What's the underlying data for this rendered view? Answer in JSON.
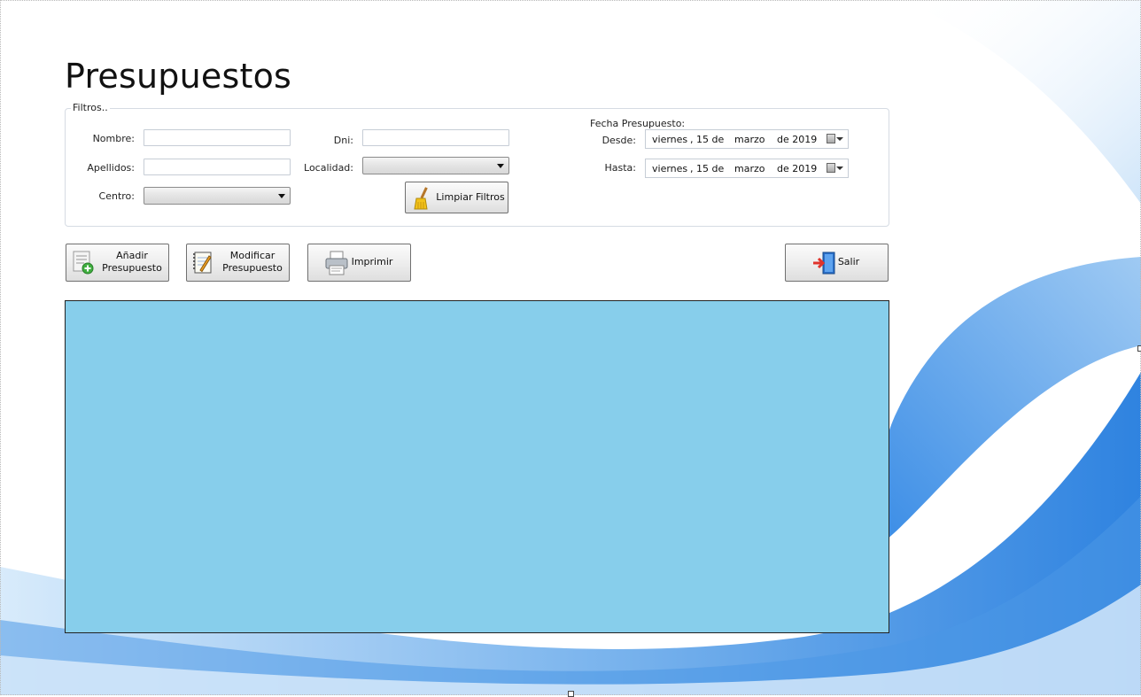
{
  "page": {
    "title": "Presupuestos"
  },
  "filters": {
    "legend": "Filtros..",
    "nombre_label": "Nombre:",
    "nombre_value": "",
    "apellidos_label": "Apellidos:",
    "apellidos_value": "",
    "centro_label": "Centro:",
    "centro_value": "",
    "dni_label": "Dni:",
    "dni_value": "",
    "localidad_label": "Localidad:",
    "localidad_value": "",
    "clear_button": "Limpiar Filtros",
    "fecha_heading": "Fecha Presupuesto:",
    "desde_label": "Desde:",
    "hasta_label": "Hasta:",
    "desde": {
      "weekday": "viernes",
      "day": ", 15 de",
      "month": "marzo",
      "year": "de 2019"
    },
    "hasta": {
      "weekday": "viernes",
      "day": ", 15 de",
      "month": "marzo",
      "year": "de 2019"
    }
  },
  "toolbar": {
    "add": {
      "line1": "Añadir",
      "line2": "Presupuesto"
    },
    "edit": {
      "line1": "Modificar",
      "line2": "Presupuesto"
    },
    "print": "Imprimir",
    "exit": "Salir"
  },
  "grid": {
    "background": "#87CEEB"
  },
  "icons": [
    "broom-icon",
    "add-document-icon",
    "edit-notepad-icon",
    "printer-icon",
    "exit-door-icon",
    "calendar-icon"
  ]
}
